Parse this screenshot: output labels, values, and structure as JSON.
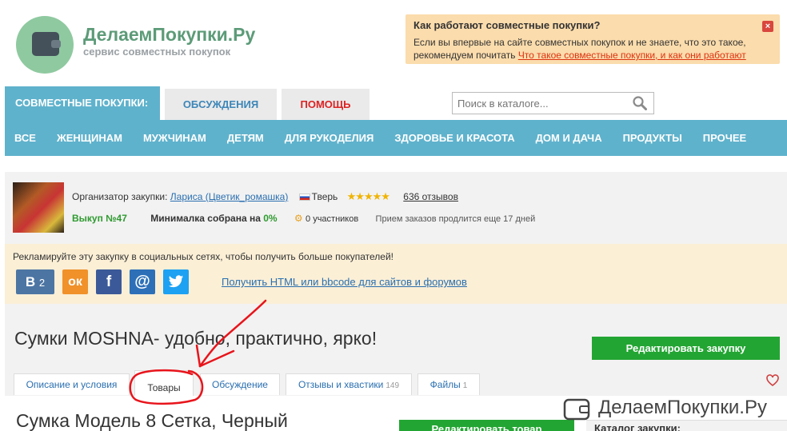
{
  "header": {
    "site_title": "ДелаемПокупки.Ру",
    "site_subtitle": "сервис совместных покупок"
  },
  "info_box": {
    "title": "Как работают совместные покупки?",
    "text": "Если вы впервые на сайте совместных покупок и не знаете, что это такое, рекомендуем почитать ",
    "link": "Что такое совместные покупки, и как они работают",
    "close": "×"
  },
  "top_tabs": {
    "main": "СОВМЕСТНЫЕ ПОКУПКИ:",
    "discussions": "ОБСУЖДЕНИЯ",
    "help": "ПОМОЩЬ"
  },
  "search": {
    "placeholder": "Поиск в каталоге..."
  },
  "categories": [
    "ВСЕ",
    "ЖЕНЩИНАМ",
    "МУЖЧИНАМ",
    "ДЕТЯМ",
    "ДЛЯ РУКОДЕЛИЯ",
    "ЗДОРОВЬЕ И КРАСОТА",
    "ДОМ И ДАЧА",
    "ПРОДУКТЫ",
    "ПРОЧЕЕ"
  ],
  "organizer": {
    "label": "Организатор закупки:",
    "name": "Лариса (Цветик_ромашка)",
    "city": "Тверь",
    "stars": "★★★★★",
    "reviews": "636 отзывов",
    "batch": "Выкуп №47",
    "min_label": "Минималка собрана на ",
    "min_value": "0%",
    "participants": "0 участников",
    "orders": "Прием заказов продлится еще 17 дней"
  },
  "promo": {
    "text": "Рекламируйте эту закупку в социальных сетях, чтобы получить больше покупателей!",
    "vk_count": "2",
    "link": "Получить HTML или bbcode для сайтов и форумов"
  },
  "purchase": {
    "title": "Сумки MOSHNA- удобно, практично, ярко!",
    "edit_button": "Редактировать закупку"
  },
  "subtabs": {
    "description": "Описание и условия",
    "goods": "Товары",
    "discussion": "Обсуждение",
    "reviews": "Отзывы и хвастики",
    "reviews_count": "149",
    "files": "Файлы",
    "files_count": "1"
  },
  "product": {
    "title": "Сумка Модель 8 Сетка, Черный",
    "edit_button": "Редактировать товар",
    "catalog_label": "Каталог закупки:"
  },
  "watermark": {
    "text": "ДелаемПокупки.Ру"
  },
  "colors": {
    "accent": "#5fb2cc",
    "green_button": "#23a533",
    "info_bg": "#fbdcac",
    "annotation": "#e8141b"
  }
}
